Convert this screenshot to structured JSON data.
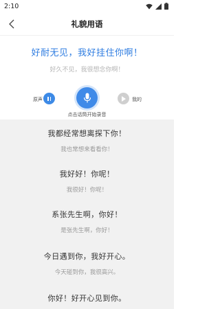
{
  "status_bar": {
    "time": "2:10",
    "icons": [
      "wifi-icon",
      "signal-icon",
      "battery-icon"
    ]
  },
  "nav": {
    "title": "礼貌用语",
    "back_icon": "chevron-left-icon"
  },
  "current": {
    "phrase": "好耐无见，我好挂住你啊！",
    "translation": "好久不见，我很想念你啊！"
  },
  "controls": {
    "original_label": "原声",
    "mine_label": "我的",
    "hint": "点击话筒开始录音",
    "colors": {
      "accent": "#3f8ae8",
      "disabled": "#cfcfcf"
    }
  },
  "phrases": [
    {
      "text": "我都经常想离探下你！",
      "sub": "我也常想来看看你！"
    },
    {
      "text": "我好好！你呢！",
      "sub": "我很好！你呢！"
    },
    {
      "text": "系张先生啊，你好！",
      "sub": "是张先生啊，你好！"
    },
    {
      "text": "今日遇到你，我好开心。",
      "sub": "今天碰到你，我很高兴。"
    },
    {
      "text": "你好！好开心见到你。",
      "sub": ""
    }
  ]
}
